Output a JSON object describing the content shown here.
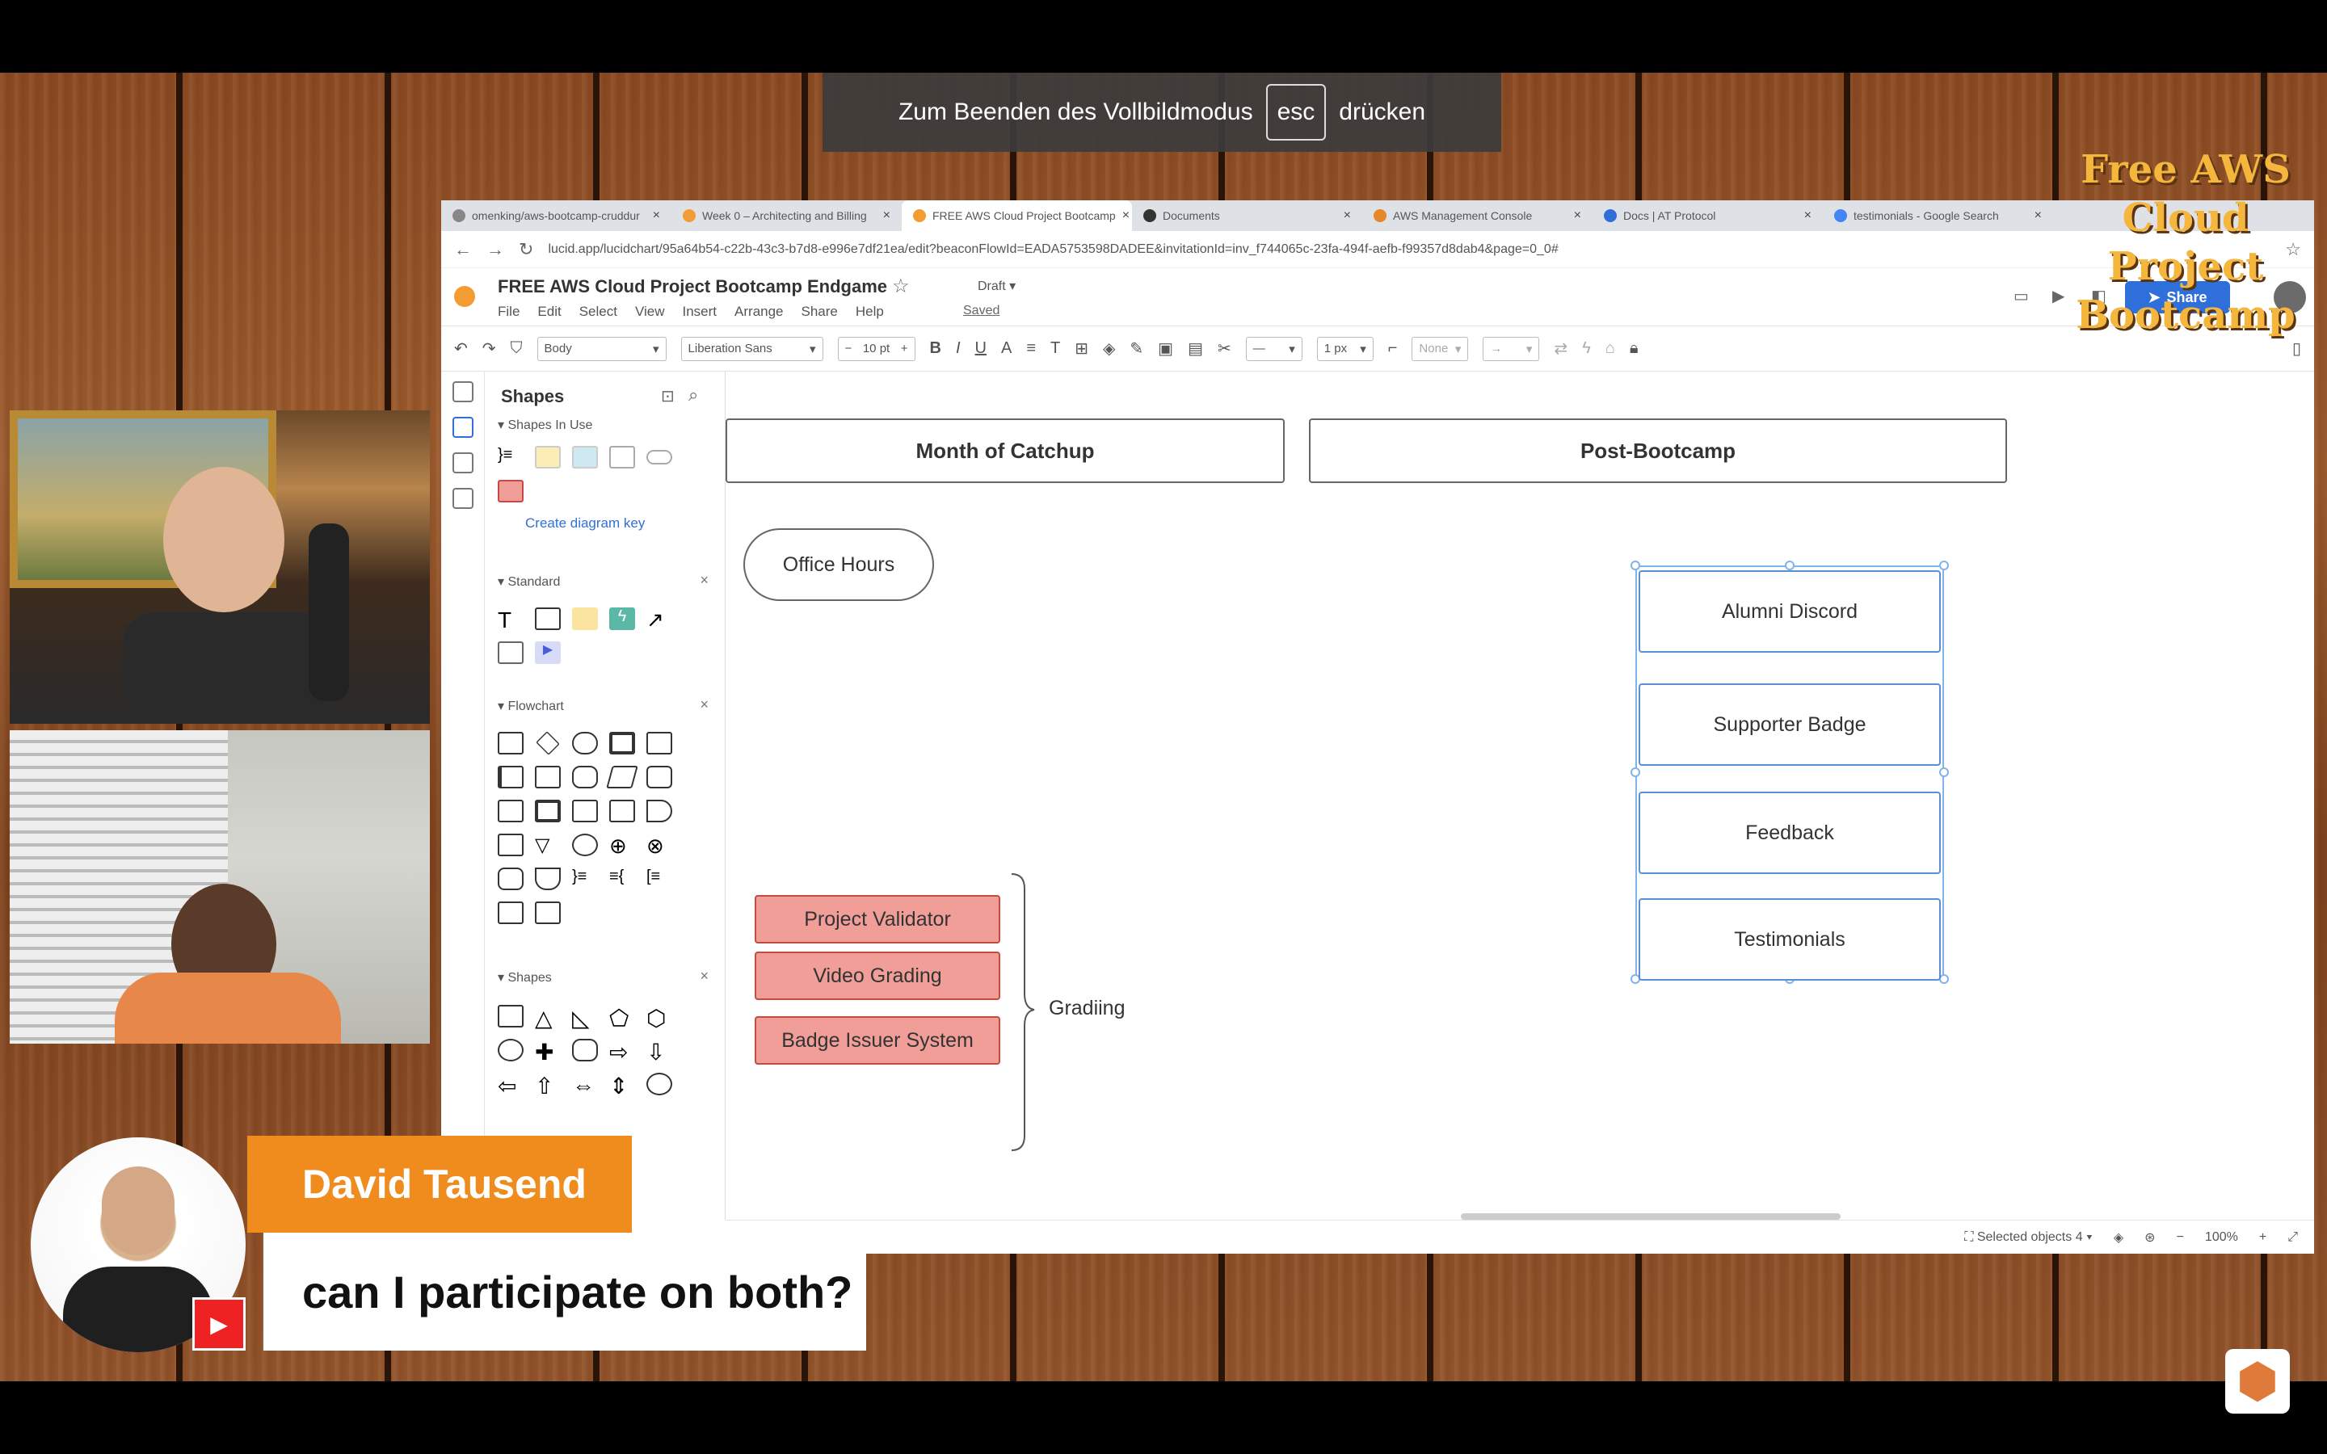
{
  "banner": {
    "before": "Zum Beenden des Vollbildmodus",
    "key": "esc",
    "after": "drücken"
  },
  "browser": {
    "tabs": [
      "omenking/aws-bootcamp-cruddur",
      "Week 0 – Architecting and Billing",
      "FREE AWS Cloud Project Bootcamp",
      "Documents",
      "AWS Management Console",
      "Docs | AT Protocol",
      "testimonials - Google Search"
    ],
    "url": "lucid.app/lucidchart/95a64b54-c22b-43c3-b7d8-e996e7df21ea/edit?beaconFlowId=EADA5753598DADEE&invitationId=inv_f744065c-23fa-494f-aefb-f99357d8dab4&page=0_0#"
  },
  "lucid": {
    "title": "FREE AWS Cloud Project Bootcamp Endgame",
    "status": "Draft ▾",
    "menu": [
      "File",
      "Edit",
      "Select",
      "View",
      "Insert",
      "Arrange",
      "Share",
      "Help"
    ],
    "saved": "Saved",
    "share_label": "Share"
  },
  "toolbar": {
    "style": "Body",
    "font": "Liberation Sans",
    "font_size": "10 pt",
    "line_width": "1 px",
    "arrow_start": "None"
  },
  "shapes": {
    "title": "Shapes",
    "sections": [
      "Shapes In Use",
      "Standard",
      "Flowchart",
      "Shapes"
    ],
    "diagram_key": "Create diagram key"
  },
  "diagram": {
    "lanes": [
      "Month of Catchup",
      "Post-Bootcamp"
    ],
    "office_hours": "Office Hours",
    "grading_items": [
      "Project Validator",
      "Video Grading",
      "Badge Issuer System"
    ],
    "grading_label": "Gradiing",
    "post_bootcamp_items": [
      "Alumni Discord",
      "Supporter Badge",
      "Feedback",
      "Testimonials"
    ]
  },
  "status": {
    "selected": "Selected objects 4",
    "zoom": "100%"
  },
  "overlay": {
    "logo": [
      "Free AWS",
      "Cloud Project",
      "Bootcamp"
    ]
  },
  "chat": {
    "name": "David Tausend",
    "message": "can I participate on both?"
  }
}
